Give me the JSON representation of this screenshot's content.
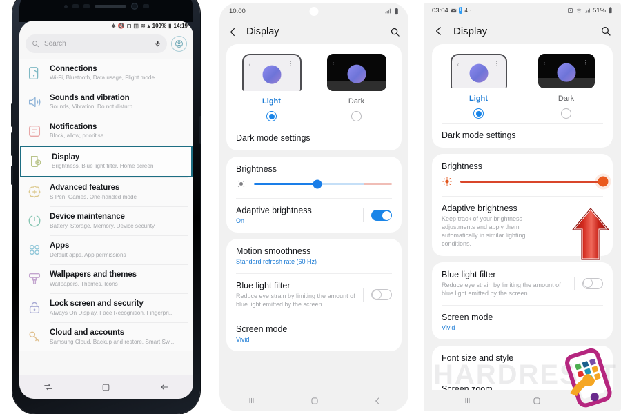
{
  "panel1": {
    "device_name": "samsung-galaxy-s8",
    "status_bar": {
      "icons": "bluetooth mute dnd nfc vpn signal",
      "battery": "100%",
      "time": "14:19"
    },
    "search": {
      "placeholder": "Search",
      "mic_icon": "microphone-icon",
      "account_icon": "account-icon"
    },
    "items": [
      {
        "title": "Connections",
        "sub": "Wi-Fi, Bluetooth, Data usage, Flight mode",
        "icon": "connections-icon",
        "color": "#7fb9c4",
        "selected": false
      },
      {
        "title": "Sounds and vibration",
        "sub": "Sounds, Vibration, Do not disturb",
        "icon": "sound-icon",
        "color": "#8fb4d8",
        "selected": false
      },
      {
        "title": "Notifications",
        "sub": "Block, allow, prioritise",
        "icon": "notifications-icon",
        "color": "#e8a7a7",
        "selected": false
      },
      {
        "title": "Display",
        "sub": "Brightness, Blue light filter, Home screen",
        "icon": "display-icon",
        "color": "#b9c48a",
        "selected": true
      },
      {
        "title": "Advanced features",
        "sub": "S Pen, Games, One-handed mode",
        "icon": "advanced-icon",
        "color": "#dcc98e",
        "selected": false
      },
      {
        "title": "Device maintenance",
        "sub": "Battery, Storage, Memory, Device security",
        "icon": "maintenance-icon",
        "color": "#86c5b2",
        "selected": false
      },
      {
        "title": "Apps",
        "sub": "Default apps, App permissions",
        "icon": "apps-icon",
        "color": "#8fc6d8",
        "selected": false
      },
      {
        "title": "Wallpapers and themes",
        "sub": "Wallpapers, Themes, Icons",
        "icon": "wallpaper-icon",
        "color": "#c3a5cf",
        "selected": false
      },
      {
        "title": "Lock screen and security",
        "sub": "Always On Display, Face Recognition, Fingerpri..",
        "icon": "lock-icon",
        "color": "#a8aad4",
        "selected": false
      },
      {
        "title": "Cloud and accounts",
        "sub": "Samsung Cloud, Backup and restore, Smart Sw...",
        "icon": "key-icon",
        "color": "#e0c08f",
        "selected": false
      }
    ],
    "nav": {
      "recents": "recents-icon",
      "home": "home-icon",
      "back": "back-icon"
    },
    "highlight_color": "#1d6e83"
  },
  "panel2": {
    "status_bar": {
      "time": "10:00",
      "signal_icon": "signal-icon",
      "battery_icon": "battery-icon"
    },
    "appbar": {
      "back_icon": "back-chevron-icon",
      "title": "Display",
      "search_icon": "search-icon"
    },
    "modes": [
      {
        "label": "Light",
        "selected": true
      },
      {
        "label": "Dark",
        "selected": false
      }
    ],
    "dark_mode_settings": "Dark mode settings",
    "brightness": {
      "title": "Brightness",
      "icon": "brightness-icon",
      "value_pct": 46
    },
    "adaptive_brightness": {
      "title": "Adaptive brightness",
      "sub": "On",
      "toggle": "on"
    },
    "motion_smoothness": {
      "title": "Motion smoothness",
      "sub": "Standard refresh rate (60 Hz)"
    },
    "blue_light_filter": {
      "title": "Blue light filter",
      "sub": "Reduce eye strain by limiting the amount of blue light emitted by the screen.",
      "toggle": "off"
    },
    "screen_mode": {
      "title": "Screen mode",
      "sub": "Vivid"
    },
    "nav": {
      "recents": "recents-icon",
      "home": "home-icon",
      "back": "back-icon"
    }
  },
  "panel3": {
    "status_bar": {
      "time": "03:04",
      "left_icons": "message-icon info-badge",
      "left_count": "4",
      "alarm_icon": "alarm-icon",
      "wifi_icon": "wifi-icon",
      "signal_icon": "signal-icon",
      "battery": "51%"
    },
    "appbar": {
      "back_icon": "back-chevron-icon",
      "title": "Display",
      "search_icon": "search-icon"
    },
    "modes": [
      {
        "label": "Light",
        "selected": true
      },
      {
        "label": "Dark",
        "selected": false
      }
    ],
    "dark_mode_settings": "Dark mode settings",
    "brightness": {
      "title": "Brightness",
      "icon": "brightness-icon",
      "value_pct": 100
    },
    "adaptive_brightness": {
      "title": "Adaptive brightness",
      "sub": "Keep track of your brightness adjustments and apply them automatically in similar lighting conditions."
    },
    "blue_light_filter": {
      "title": "Blue light filter",
      "sub": "Reduce eye strain by limiting the amount of blue light emitted by the screen.",
      "toggle": "off"
    },
    "screen_mode": {
      "title": "Screen mode",
      "sub": "Vivid"
    },
    "font_size_and_style": "Font size and style",
    "screen_zoom": "Screen zoom",
    "nav": {
      "recents": "recents-icon",
      "home": "home-icon"
    },
    "annotation_arrow": "red-up-arrow",
    "accent_color": "#d9462a"
  },
  "watermark": {
    "text": "HARDRESET",
    "logo": "hardreset-logo"
  }
}
